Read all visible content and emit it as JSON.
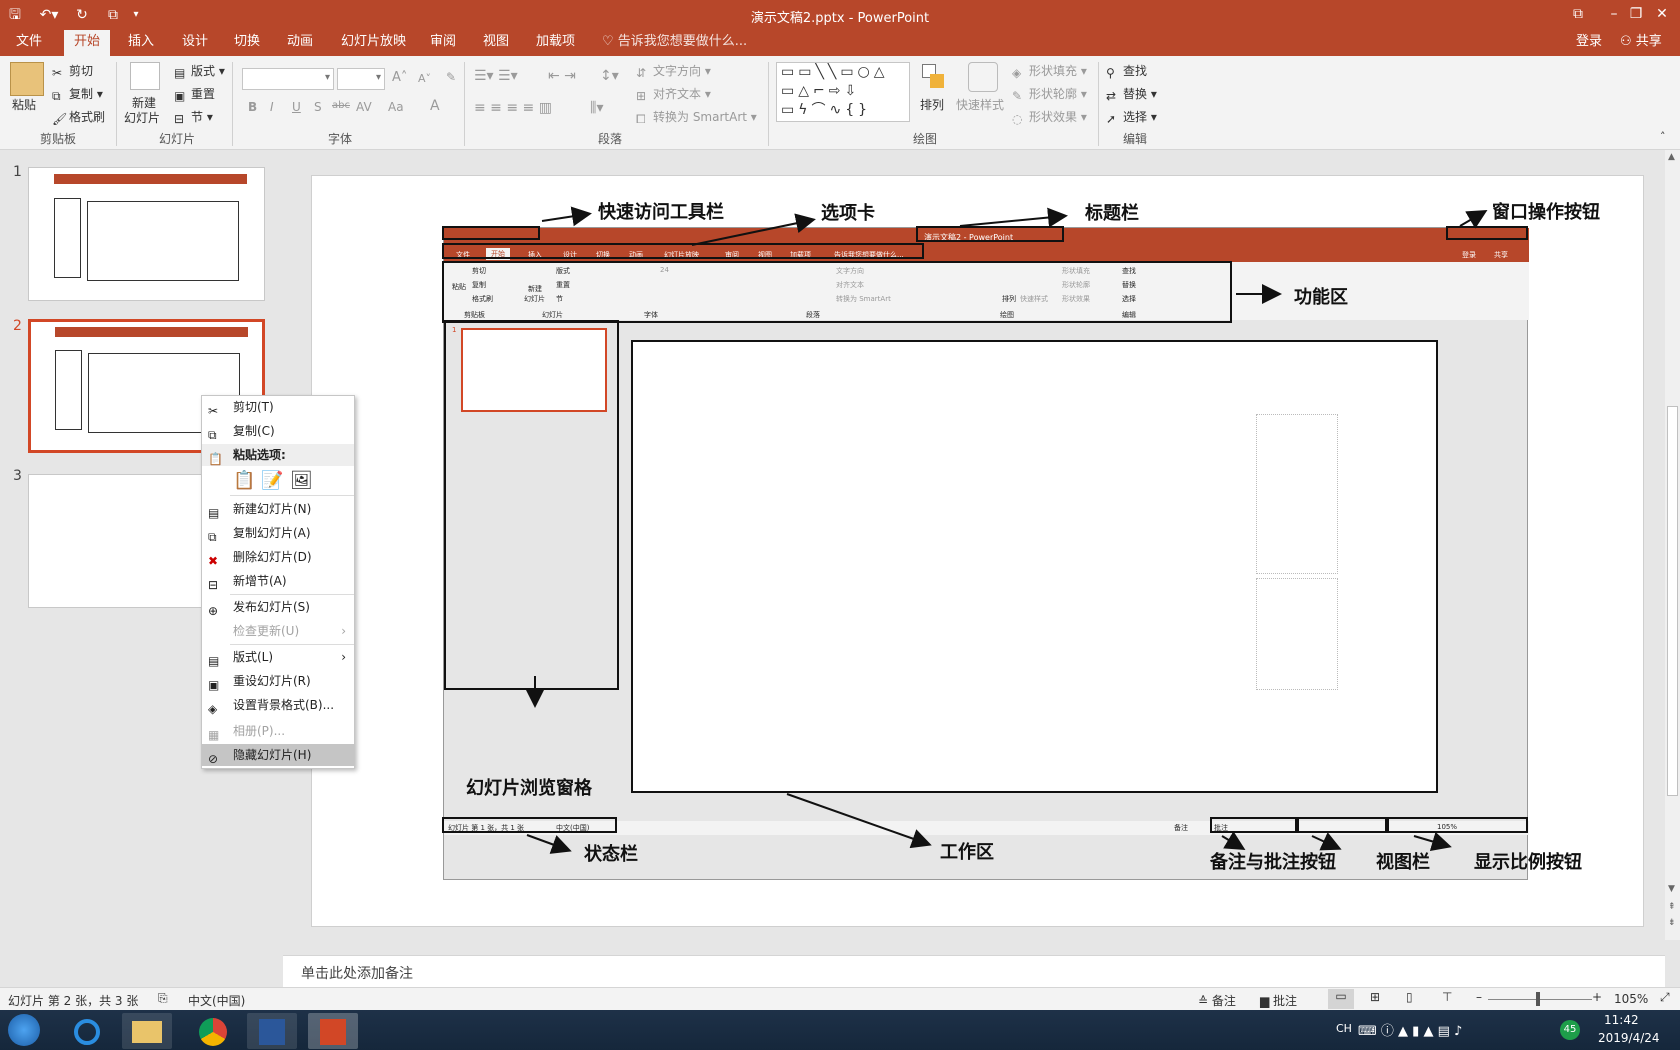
{
  "window": {
    "title": "演示文稿2.pptx - PowerPoint",
    "controls": [
      "restore-ribbon",
      "minimize",
      "maximize",
      "close"
    ]
  },
  "qat": {
    "save": "save-icon",
    "undo": "undo-icon",
    "redo": "redo-icon",
    "present": "present-from-start-icon",
    "customize": "customize-qat-icon"
  },
  "tabs": [
    "文件",
    "开始",
    "插入",
    "设计",
    "切换",
    "动画",
    "幻灯片放映",
    "审阅",
    "视图",
    "加载项"
  ],
  "tell_me": "告诉我您想要做什么...",
  "signin": "登录",
  "share": "共享",
  "ribbon": {
    "clipboard": {
      "paste": "粘贴",
      "cut": "剪切",
      "copy": "复制",
      "format_painter": "格式刷",
      "label": "剪贴板"
    },
    "slides": {
      "new_slide": "新建",
      "new_slide2": "幻灯片",
      "layout": "版式",
      "reset": "重置",
      "section": "节",
      "label": "幻灯片"
    },
    "font": {
      "label": "字体",
      "bold": "B",
      "italic": "I",
      "underline": "U",
      "shadow": "S",
      "strike": "abc",
      "spacing": "AV",
      "case": "Aa",
      "color": "A",
      "grow": "A",
      "shrink": "A"
    },
    "paragraph": {
      "label": "段落",
      "text_direction": "文字方向",
      "align_text": "对齐文本",
      "smartart": "转换为 SmartArt"
    },
    "drawing": {
      "label": "绘图",
      "arrange": "排列",
      "quick_styles": "快速样式",
      "fill": "形状填充",
      "outline": "形状轮廓",
      "effects": "形状效果"
    },
    "editing": {
      "label": "编辑",
      "find": "查找",
      "replace": "替换",
      "select": "选择"
    }
  },
  "thumbnails": [
    {
      "num": "1"
    },
    {
      "num": "2",
      "selected": true
    },
    {
      "num": "3"
    }
  ],
  "context_menu": [
    {
      "label": "剪切(T)",
      "icon": "scissors-icon",
      "disabled": false
    },
    {
      "label": "复制(C)",
      "icon": "copy-icon",
      "disabled": false
    },
    {
      "label": "粘贴选项:",
      "icon": "paste-icon",
      "header": true
    },
    {
      "label": "新建幻灯片(N)",
      "icon": "new-slide-icon",
      "disabled": false
    },
    {
      "label": "复制幻灯片(A)",
      "icon": "duplicate-slide-icon",
      "disabled": false
    },
    {
      "label": "删除幻灯片(D)",
      "icon": "delete-slide-icon",
      "disabled": false
    },
    {
      "label": "新增节(A)",
      "icon": "add-section-icon",
      "disabled": false
    },
    {
      "label": "发布幻灯片(S)",
      "icon": "publish-slides-icon",
      "disabled": false
    },
    {
      "label": "检查更新(U)",
      "icon": "",
      "disabled": true,
      "submenu": true
    },
    {
      "label": "版式(L)",
      "icon": "layout-icon",
      "disabled": false,
      "submenu": true
    },
    {
      "label": "重设幻灯片(R)",
      "icon": "reset-slide-icon",
      "disabled": false
    },
    {
      "label": "设置背景格式(B)...",
      "icon": "format-background-icon",
      "disabled": false
    },
    {
      "label": "相册(P)...",
      "icon": "photo-album-icon",
      "disabled": true
    },
    {
      "label": "隐藏幻灯片(H)",
      "icon": "hide-slide-icon",
      "disabled": false,
      "highlighted": true
    }
  ],
  "annotations": {
    "qat": "快速访问工具栏",
    "tabs": "选项卡",
    "title": "标题栏",
    "window_buttons": "窗口操作按钮",
    "ribbon": "功能区",
    "slide_pane": "幻灯片浏览窗格",
    "status": "状态栏",
    "work": "工作区",
    "notes_comments": "备注与批注按钮",
    "views": "视图栏",
    "zoom": "显示比例按钮"
  },
  "mini": {
    "title": "演示文稿2 - PowerPoint",
    "tabs": [
      "文件",
      "开始",
      "插入",
      "设计",
      "切换",
      "动画",
      "幻灯片放映",
      "审阅",
      "视图",
      "加载项"
    ],
    "tell_me": "告诉我您想要做什么...",
    "signin": "登录",
    "share": "共享",
    "paste": "粘贴",
    "cut": "剪切",
    "copy": "复制",
    "format_painter": "格式刷",
    "new_slide": "新建",
    "new_slide2": "幻灯片",
    "layout": "版式",
    "reset": "重置",
    "section": "节",
    "font_size": "24",
    "text_direction": "文字方向",
    "align_text": "对齐文本",
    "smartart": "转换为 SmartArt",
    "arrange": "排列",
    "quick_styles": "快速样式",
    "fill": "形状填充",
    "outline": "形状轮廓",
    "effects": "形状效果",
    "find": "查找",
    "replace": "替换",
    "select": "选择",
    "labels": [
      "剪贴板",
      "幻灯片",
      "字体",
      "段落",
      "绘图",
      "编辑"
    ],
    "slide_num": "1",
    "status_left": "幻灯片 第 1 张，共 1 张",
    "status_lang": "中文(中国)",
    "notes": "备注",
    "comments": "批注",
    "zoom": "105%"
  },
  "notes_placeholder": "单击此处添加备注",
  "status": {
    "slide_info": "幻灯片 第 2 张，共 3 张",
    "language": "中文(中国)",
    "notes": "备注",
    "comments": "批注",
    "zoom": "105%",
    "zoom_level_percent": 105
  },
  "taskbar": {
    "lang": "CH",
    "time": "11:42",
    "date": "2019/4/24",
    "badge": "45",
    "apps": [
      "internet-explorer",
      "file-explorer",
      "chrome",
      "word",
      "powerpoint"
    ]
  },
  "colors": {
    "accent": "#b7472a",
    "selection": "#d24726"
  }
}
